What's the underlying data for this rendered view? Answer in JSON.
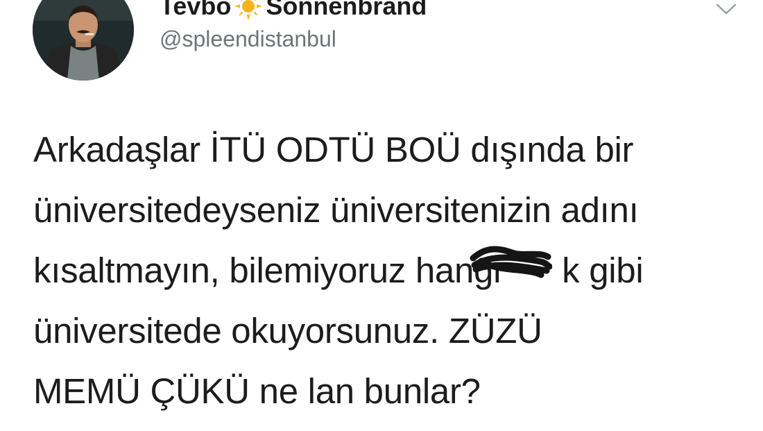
{
  "author": {
    "display_name_before": "Tevbo",
    "display_name_after": "Sonnenbrand",
    "handle": "@spleendistanbul",
    "avatar_icon": "avatar-photo",
    "name_emoji_icon": "sun-icon"
  },
  "menu": {
    "icon": "chevron-down-icon"
  },
  "tweet": {
    "lines": [
      "Arkadaşlar İTÜ ODTÜ BOÜ dışında bir",
      "üniversitedeyseniz üniversitenizin adını",
      "kısaltmayın, bilemiyoruz hangi",
      "üniversitede okuyorsunuz. ZÜZÜ",
      "MEMÜ ÇÜKÜ ne lan bunlar?"
    ],
    "line3_after_scribble": "k gibi"
  },
  "colors": {
    "text": "#1c1c1c",
    "handle": "#6f7478",
    "sun": "#f5b31c",
    "chevron": "#9aa0a6"
  }
}
